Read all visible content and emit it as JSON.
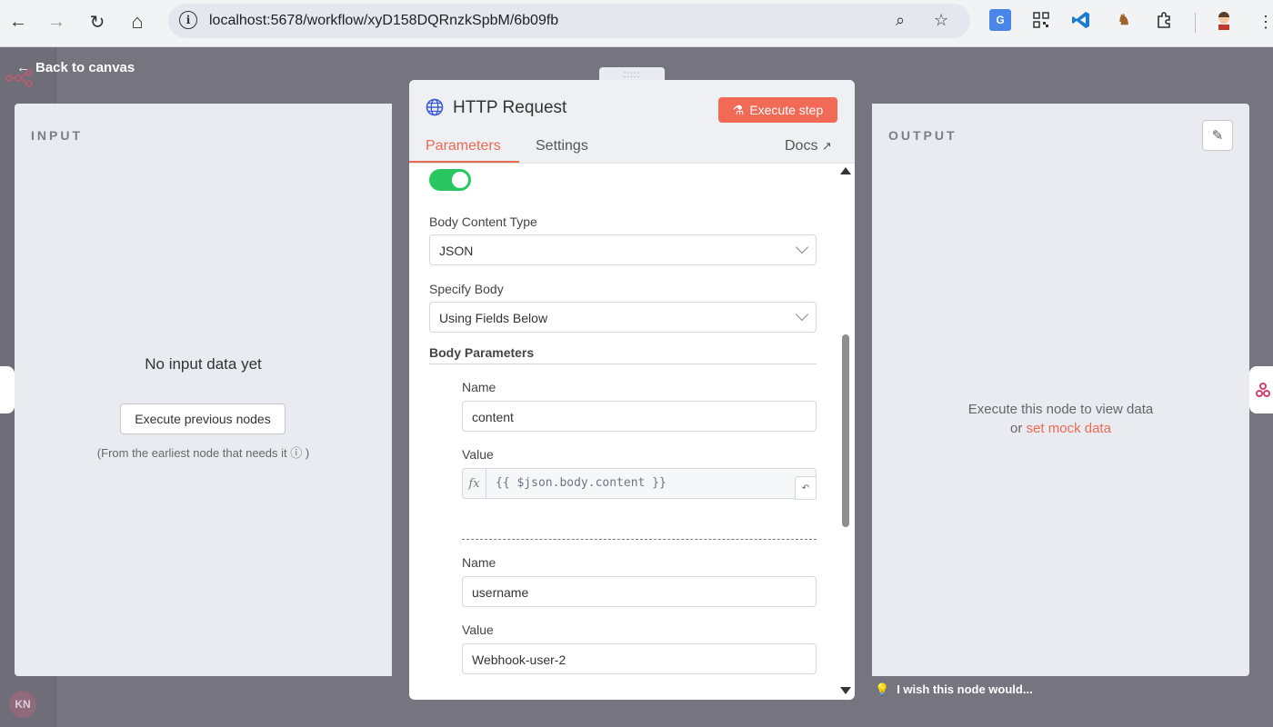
{
  "browser": {
    "url": "localhost:5678/workflow/xyD158DQRnzkSpbM/6b09fb",
    "back_icon": "←",
    "forward_icon": "→",
    "reload_icon": "↻",
    "home_icon": "⌂",
    "info_icon": "i",
    "zoom_icon": "⌕",
    "star_icon": "☆",
    "menu_icon": "⋮"
  },
  "canvas": {
    "back_label": "Back to canvas",
    "back_arrow": "←",
    "avatar_initials": "KN"
  },
  "input_panel": {
    "title": "INPUT",
    "empty_message": "No input data yet",
    "execute_button": "Execute previous nodes",
    "hint": "(From the earliest node that needs it ⓘ )"
  },
  "output_panel": {
    "title": "OUTPUT",
    "message_line1": "Execute this node to view data",
    "message_or": "or ",
    "mock_link": "set mock data",
    "edit_icon": "✎"
  },
  "node": {
    "drag_handle": ":::::",
    "title": "HTTP Request",
    "execute_button": "Execute step",
    "execute_icon": "⚗",
    "tabs": [
      {
        "label": "Parameters",
        "active": true
      },
      {
        "label": "Settings",
        "active": false
      }
    ],
    "docs_label": "Docs",
    "docs_icon": "↗",
    "toggle_on": true,
    "body_content_type": {
      "label": "Body Content Type",
      "value": "JSON"
    },
    "specify_body": {
      "label": "Specify Body",
      "value": "Using Fields Below"
    },
    "body_parameters_label": "Body Parameters",
    "params": [
      {
        "name_label": "Name",
        "name_value": "content",
        "value_label": "Value",
        "value": "{{ $json.body.content }}",
        "is_expression": true
      },
      {
        "name_label": "Name",
        "name_value": "username",
        "value_label": "Value",
        "value": "Webhook-user-2",
        "is_expression": false
      }
    ],
    "fx_label": "fx"
  },
  "feedback": {
    "icon": "💡",
    "text": "I wish this node would..."
  },
  "colors": {
    "accent": "#ea6a54",
    "toggle_on": "#28c75f",
    "overlay": "#75747f"
  }
}
